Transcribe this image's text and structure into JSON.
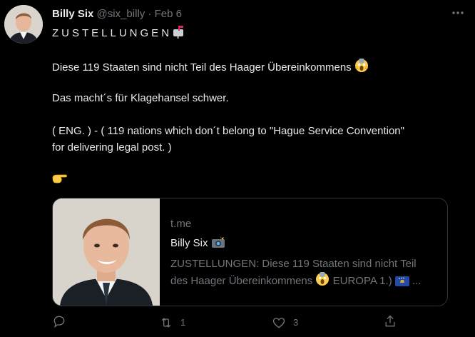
{
  "tweet": {
    "author_name": "Billy Six",
    "author_handle": "@six_billy",
    "separator": " · ",
    "date": "Feb 6",
    "line1": "ZUSTELLUNGEN",
    "line2": "Diese 119 Staaten sind nicht Teil des Haager Übereinkommens",
    "line3": "Das macht´s für Klagehansel schwer.",
    "line4": "( ENG. ) - ( 119 nations which don´t belong to \"Hague Service Convention\"",
    "line5": "for delivering legal post. )",
    "icons": {
      "more": "more-dots-icon",
      "mailbox": "mailbox-emoji",
      "scream": "scream-emoji",
      "point": "pointing-hand-emoji"
    }
  },
  "card": {
    "domain": "t.me",
    "title": "Billy Six",
    "description_line1": "ZUSTELLUNGEN: Diese 119 Staaten sind nicht Teil",
    "description_line2_a": "des Haager Übereinkommens",
    "description_line2_b": "EUROPA 1.)",
    "ellipsis": "..."
  },
  "actions": {
    "reply_count": "",
    "retweet_count": "1",
    "like_count": "3",
    "share_count": ""
  },
  "colors": {
    "background": "#000000",
    "text": "#e7e9ea",
    "muted": "#71767b",
    "border": "#2f3336"
  }
}
